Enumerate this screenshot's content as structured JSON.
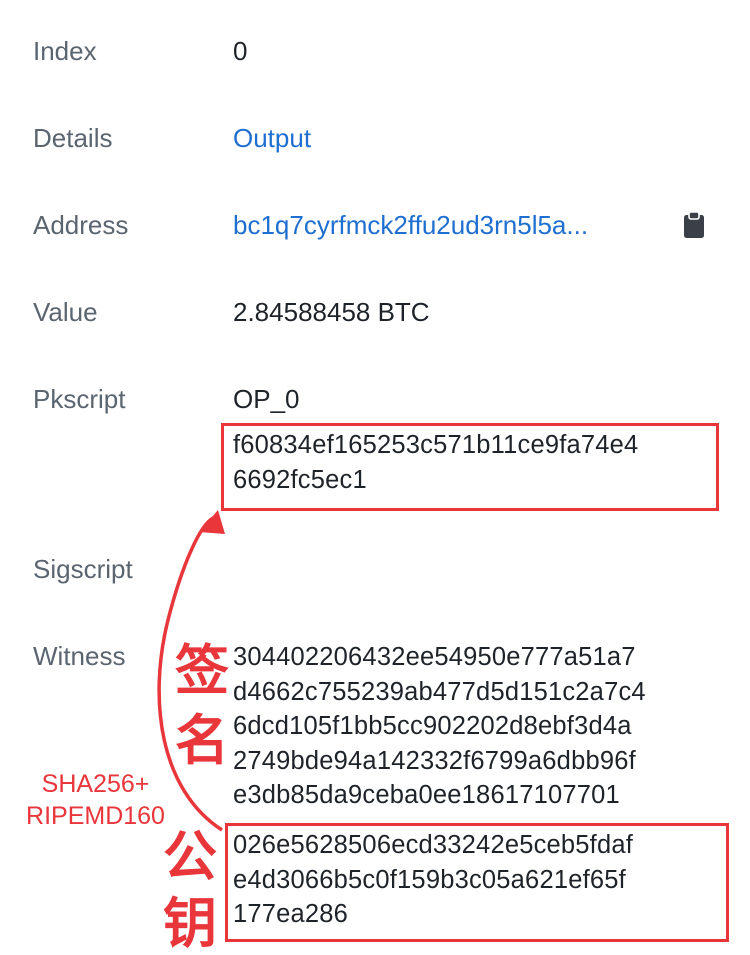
{
  "rows": {
    "index": {
      "label": "Index",
      "value": "0"
    },
    "details": {
      "label": "Details",
      "value": "Output"
    },
    "address": {
      "label": "Address",
      "value": "bc1q7cyrfmck2ffu2ud3rn5l5a..."
    },
    "value": {
      "label": "Value",
      "value": "2.84588458 BTC"
    },
    "pkscript": {
      "label": "Pkscript",
      "op": "OP_0",
      "lines": [
        "f60834ef165253c571b11ce9fa74e4",
        "6692fc5ec1"
      ]
    },
    "sigscript": {
      "label": "Sigscript"
    },
    "witness": {
      "label": "Witness",
      "signature_lines": [
        "304402206432ee54950e777a51a7",
        "d4662c755239ab477d5d151c2a7c4",
        "6dcd105f1bb5cc902202d8ebf3d4a",
        "2749bde94a142332f6799a6dbb96f",
        "e3db85da9ceba0ee18617107701"
      ],
      "pubkey_lines": [
        "026e5628506ecd33242e5ceb5fdaf",
        "e4d3066b5c0f159b3c05a621ef65f",
        "177ea286"
      ]
    }
  },
  "annotations": {
    "hash_label_1": "SHA256+",
    "hash_label_2": "RIPEMD160",
    "signature_char_1": "签",
    "signature_char_2": "名",
    "pubkey_char_1": "公",
    "pubkey_char_2": "钥"
  },
  "icons": {
    "copy": "clipboard-icon"
  },
  "colors": {
    "link": "#1f6fd0",
    "annotation": "#e8363b"
  }
}
